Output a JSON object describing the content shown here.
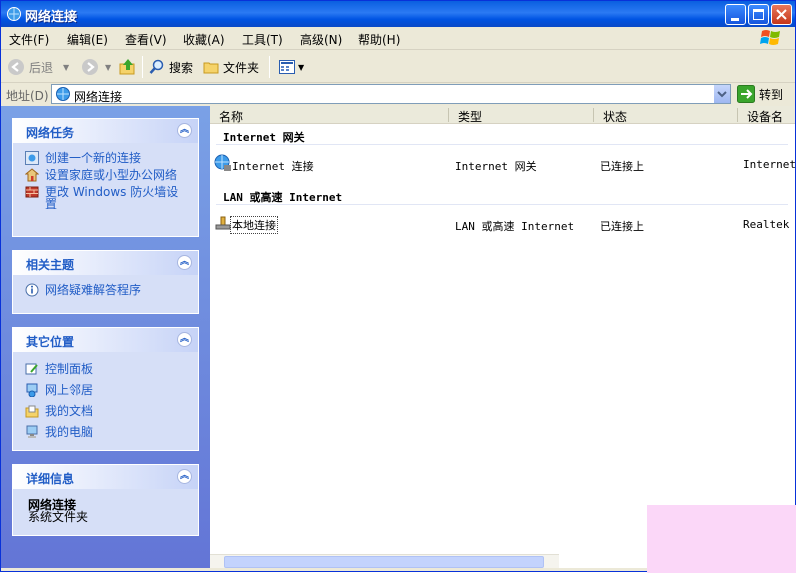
{
  "window": {
    "title": "网络连接"
  },
  "menu": [
    "文件(F)",
    "编辑(E)",
    "查看(V)",
    "收藏(A)",
    "工具(T)",
    "高级(N)",
    "帮助(H)"
  ],
  "toolbar": {
    "back": "后退",
    "search": "搜索",
    "folders": "文件夹"
  },
  "address": {
    "label": "地址(D)",
    "value": "网络连接",
    "go": "转到"
  },
  "panels": {
    "network_tasks": {
      "title": "网络任务",
      "items": [
        "创建一个新的连接",
        "设置家庭或小型办公网络",
        "更改 Windows 防火墙设置"
      ]
    },
    "related": {
      "title": "相关主题",
      "items": [
        "网络疑难解答程序"
      ]
    },
    "other_places": {
      "title": "其它位置",
      "items": [
        "控制面板",
        "网上邻居",
        "我的文档",
        "我的电脑"
      ]
    },
    "details": {
      "title": "详细信息",
      "name": "网络连接",
      "desc": "系统文件夹"
    }
  },
  "columns": [
    "名称",
    "类型",
    "状态",
    "设备名"
  ],
  "groups": [
    {
      "title": "Internet 网关",
      "rows": [
        {
          "name": "Internet 连接",
          "type": "Internet 网关",
          "status": "已连接上",
          "device": "Internet"
        }
      ]
    },
    {
      "title": "LAN 或高速 Internet",
      "rows": [
        {
          "name": "本地连接",
          "type": "LAN 或高速 Internet",
          "status": "已连接上",
          "device": "Realtek"
        }
      ]
    }
  ]
}
